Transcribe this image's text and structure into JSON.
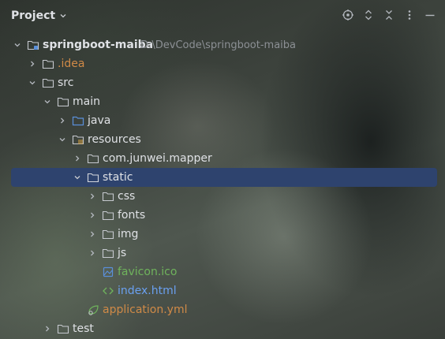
{
  "panel": {
    "title": "Project",
    "toolbar": [
      {
        "icon": "locate-icon"
      },
      {
        "icon": "expand-all-icon"
      },
      {
        "icon": "collapse-all-icon"
      },
      {
        "icon": "more-vertical-icon"
      },
      {
        "icon": "minimize-icon"
      }
    ]
  },
  "colors": {
    "folder": "#c6c9cf",
    "source_folder": "#5a8fd9",
    "excluded_label": "#d08a47",
    "html_label": "#6aa0f0",
    "ico_label": "#6fb35c",
    "yml_label": "#d08a47",
    "selection": "#2e436e"
  },
  "tree": [
    {
      "label": "springboot-maiba",
      "hint": "D:\\DevCode\\springboot-maiba",
      "icon": "module-folder-icon",
      "expanded": true,
      "bold": true
    },
    {
      "label": ".idea",
      "icon": "folder-icon",
      "expanded": false
    },
    {
      "label": "src",
      "icon": "folder-icon",
      "expanded": true
    },
    {
      "label": "main",
      "icon": "folder-icon",
      "expanded": true
    },
    {
      "label": "java",
      "icon": "source-folder-icon",
      "expanded": false
    },
    {
      "label": "resources",
      "icon": "resources-folder-icon",
      "expanded": true
    },
    {
      "label": "com.junwei.mapper",
      "icon": "folder-icon",
      "expanded": false
    },
    {
      "label": "static",
      "icon": "folder-icon",
      "expanded": true,
      "selected": true
    },
    {
      "label": "css",
      "icon": "folder-icon",
      "expanded": false
    },
    {
      "label": "fonts",
      "icon": "folder-icon",
      "expanded": false
    },
    {
      "label": "img",
      "icon": "folder-icon",
      "expanded": false
    },
    {
      "label": "js",
      "icon": "folder-icon",
      "expanded": false
    },
    {
      "label": "favicon.ico",
      "icon": "image-file-icon"
    },
    {
      "label": "index.html",
      "icon": "html-file-icon"
    },
    {
      "label": "application.yml",
      "icon": "yaml-file-icon"
    },
    {
      "label": "test",
      "icon": "folder-icon",
      "expanded": false
    }
  ]
}
